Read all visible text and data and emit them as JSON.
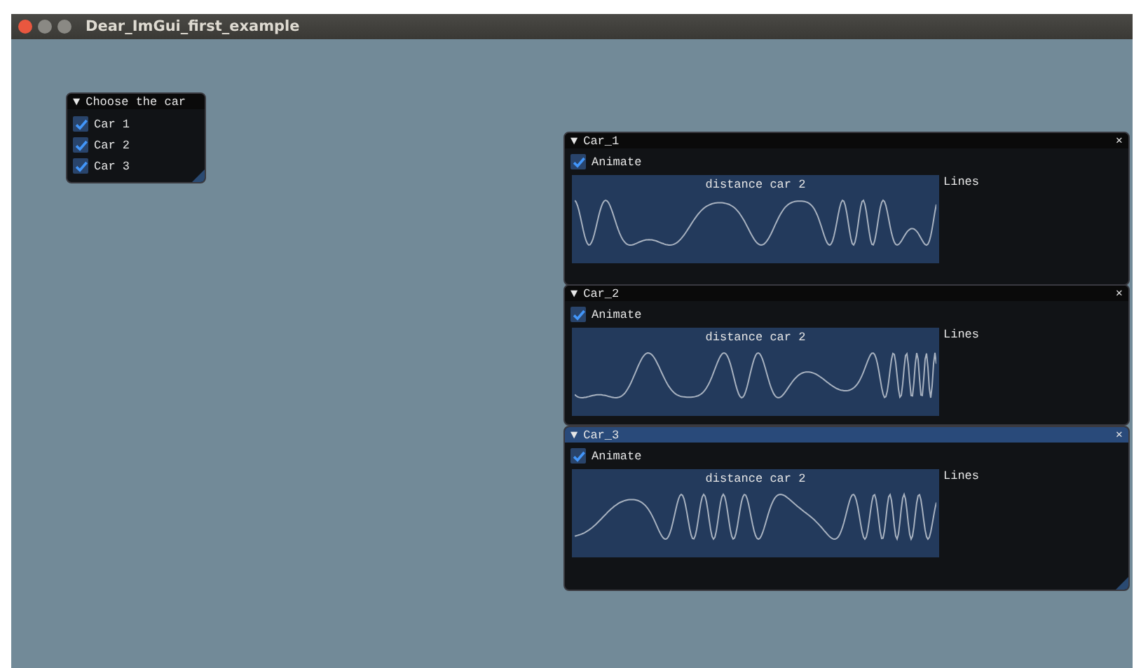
{
  "window": {
    "title": "Dear_ImGui_first_example"
  },
  "chooser": {
    "arrow": "▼",
    "title": "Choose the car",
    "focused": false,
    "items": [
      {
        "label": "Car 1",
        "checked": true
      },
      {
        "label": "Car 2",
        "checked": true
      },
      {
        "label": "Car 3",
        "checked": true
      }
    ]
  },
  "car_windows": [
    {
      "arrow": "▼",
      "title": "Car_1",
      "close": "×",
      "focused": false,
      "animate": {
        "label": "Animate",
        "checked": true
      },
      "plot": {
        "title": "distance car 2",
        "label": "Lines"
      }
    },
    {
      "arrow": "▼",
      "title": "Car_2",
      "close": "×",
      "focused": false,
      "animate": {
        "label": "Animate",
        "checked": true
      },
      "plot": {
        "title": "distance car 2",
        "label": "Lines"
      }
    },
    {
      "arrow": "▼",
      "title": "Car_3",
      "close": "×",
      "focused": true,
      "animate": {
        "label": "Animate",
        "checked": true
      },
      "plot": {
        "title": "distance car 2",
        "label": "Lines"
      }
    }
  ]
}
